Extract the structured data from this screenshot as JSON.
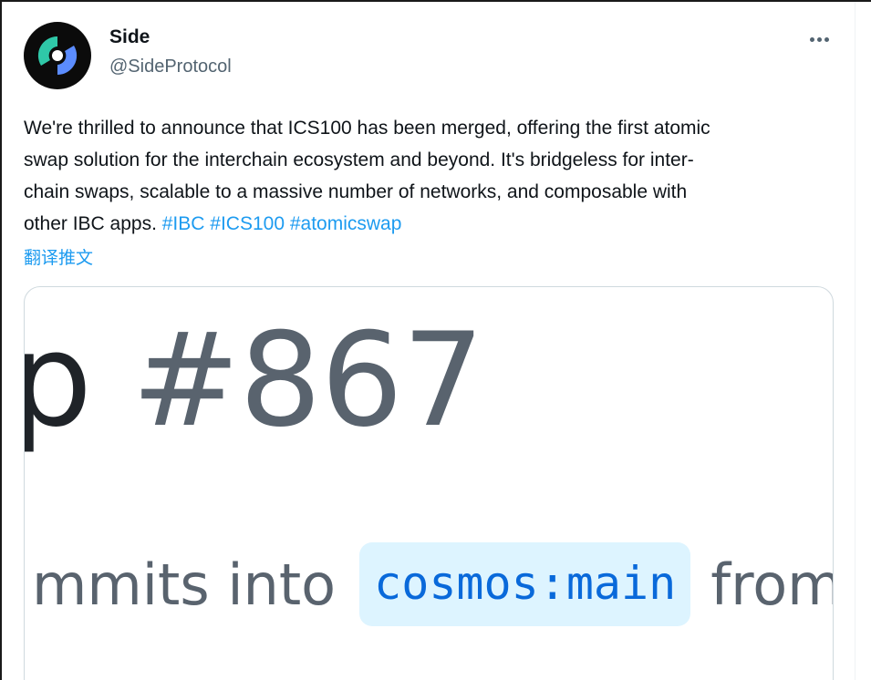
{
  "author": {
    "display_name": "Side",
    "handle": "@SideProtocol",
    "avatar_icon": "side-protocol-logo-icon"
  },
  "menu": {
    "icon": "more-horizontal-icon"
  },
  "tweet": {
    "lines": [
      "We're thrilled to announce that ICS100 has been merged, offering the first atomic",
      "swap solution for the interchain ecosystem and beyond. It's bridgeless for inter-",
      "chain swaps, scalable to a massive number of networks, and composable with",
      "other IBC apps. "
    ],
    "hashtags": [
      "#IBC",
      "#ICS100",
      "#atomicswap"
    ],
    "translate_label": "翻译推文"
  },
  "media": {
    "title_fragment": "p ",
    "pr_number": "#867",
    "subtitle_before": "mmits into",
    "branch": "cosmos:main",
    "subtitle_after": "from"
  },
  "colors": {
    "link": "#1d9bf0",
    "text": "#0f1419",
    "muted": "#536471",
    "branch_bg": "#ddf4ff",
    "branch_text": "#0969da"
  }
}
